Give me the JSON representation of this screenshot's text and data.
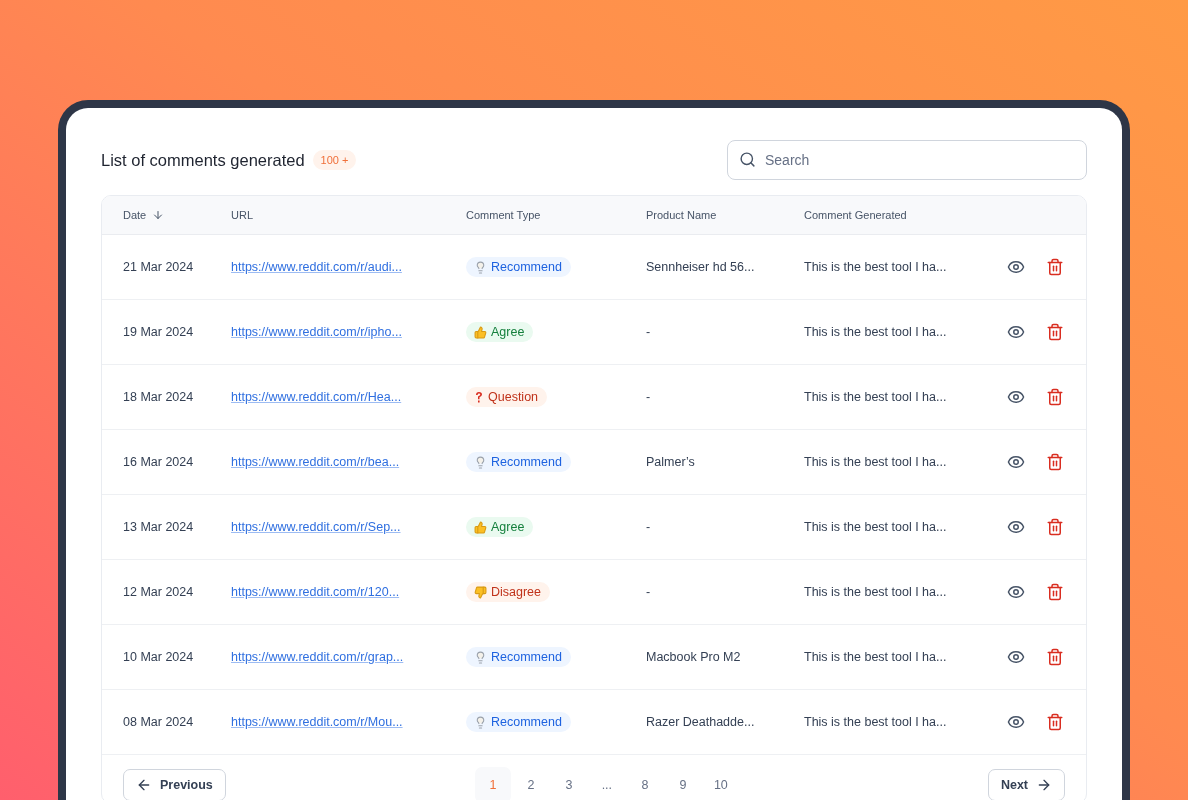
{
  "title": "List of comments generated",
  "count_badge": "100 +",
  "search": {
    "placeholder": "Search"
  },
  "table": {
    "columns": [
      {
        "label": "Date",
        "sorted": true
      },
      {
        "label": "URL",
        "sorted": false
      },
      {
        "label": "Comment Type",
        "sorted": false
      },
      {
        "label": "Product Name",
        "sorted": false
      },
      {
        "label": "Comment Generated",
        "sorted": false
      }
    ],
    "rows": [
      {
        "date": "21 Mar 2024",
        "url": "https://www.reddit.com/r/audi...",
        "type": {
          "kind": "recommend",
          "label": "Recommend"
        },
        "product": "Sennheiser hd 56...",
        "comment": "This is the best tool I ha..."
      },
      {
        "date": "19 Mar 2024",
        "url": "https://www.reddit.com/r/ipho...",
        "type": {
          "kind": "agree",
          "label": "Agree"
        },
        "product": "-",
        "comment": "This is the best tool I ha..."
      },
      {
        "date": "18 Mar 2024",
        "url": "https://www.reddit.com/r/Hea...",
        "type": {
          "kind": "question",
          "label": "Question"
        },
        "product": "-",
        "comment": "This is the best tool I ha..."
      },
      {
        "date": "16 Mar 2024",
        "url": "https://www.reddit.com/r/bea...",
        "type": {
          "kind": "recommend",
          "label": "Recommend"
        },
        "product": "Palmer’s",
        "comment": "This is the best tool I ha..."
      },
      {
        "date": "13 Mar 2024",
        "url": "https://www.reddit.com/r/Sep...",
        "type": {
          "kind": "agree",
          "label": "Agree"
        },
        "product": "-",
        "comment": "This is the best tool I ha..."
      },
      {
        "date": "12 Mar 2024",
        "url": "https://www.reddit.com/r/120...",
        "type": {
          "kind": "disagree",
          "label": "Disagree"
        },
        "product": "-",
        "comment": "This is the best tool I ha..."
      },
      {
        "date": "10 Mar 2024",
        "url": "https://www.reddit.com/r/grap...",
        "type": {
          "kind": "recommend",
          "label": "Recommend"
        },
        "product": "Macbook Pro M2",
        "comment": "This is the best tool I ha..."
      },
      {
        "date": "08 Mar 2024",
        "url": "https://www.reddit.com/r/Mou...",
        "type": {
          "kind": "recommend",
          "label": "Recommend"
        },
        "product": "Razer Deathadde...",
        "comment": "This is the best tool I ha..."
      }
    ]
  },
  "pagination": {
    "previous": "Previous",
    "next": "Next",
    "pages": [
      {
        "label": "1",
        "selected": true
      },
      {
        "label": "2",
        "selected": false
      },
      {
        "label": "3",
        "selected": false
      },
      {
        "label": "...",
        "selected": false
      },
      {
        "label": "8",
        "selected": false
      },
      {
        "label": "9",
        "selected": false
      },
      {
        "label": "10",
        "selected": false
      }
    ]
  }
}
